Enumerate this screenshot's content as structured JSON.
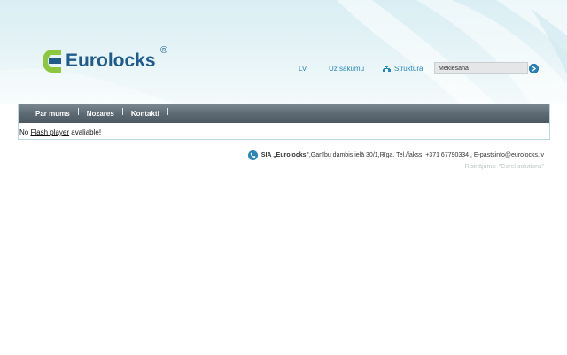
{
  "brand": {
    "name": "Eurolocks",
    "registered_mark": "®",
    "color": "#1f5c8c",
    "logo_accent": "#8dc63f"
  },
  "header": {
    "language_link": "LV",
    "home_link": "Uz sākumu",
    "structure_link": "Struktūra",
    "structure_icon": "sitemap-icon",
    "search": {
      "value": "Meklēšana",
      "button_icon": "arrow-right-icon"
    }
  },
  "nav": {
    "items": [
      "Par mums",
      "Nozares",
      "Kontakti"
    ]
  },
  "content": {
    "message_before": "No ",
    "flash_link": "Flash player",
    "message_after": " avaliable!"
  },
  "footer": {
    "phone_icon": "phone-icon",
    "company": "SIA „Eurolocks\"",
    "address": ",Ganību dambis ielā 30/1,Rīga. Tel./fakss: +371 67790334 , E-pasts ",
    "email": "info@eurolocks.lv",
    "credit": "Risinājums: \"Corel solutions\""
  },
  "colors": {
    "accent": "#2a86b8",
    "nav_bg": "#5d6a74",
    "header_bg": "#e1f1f5"
  }
}
